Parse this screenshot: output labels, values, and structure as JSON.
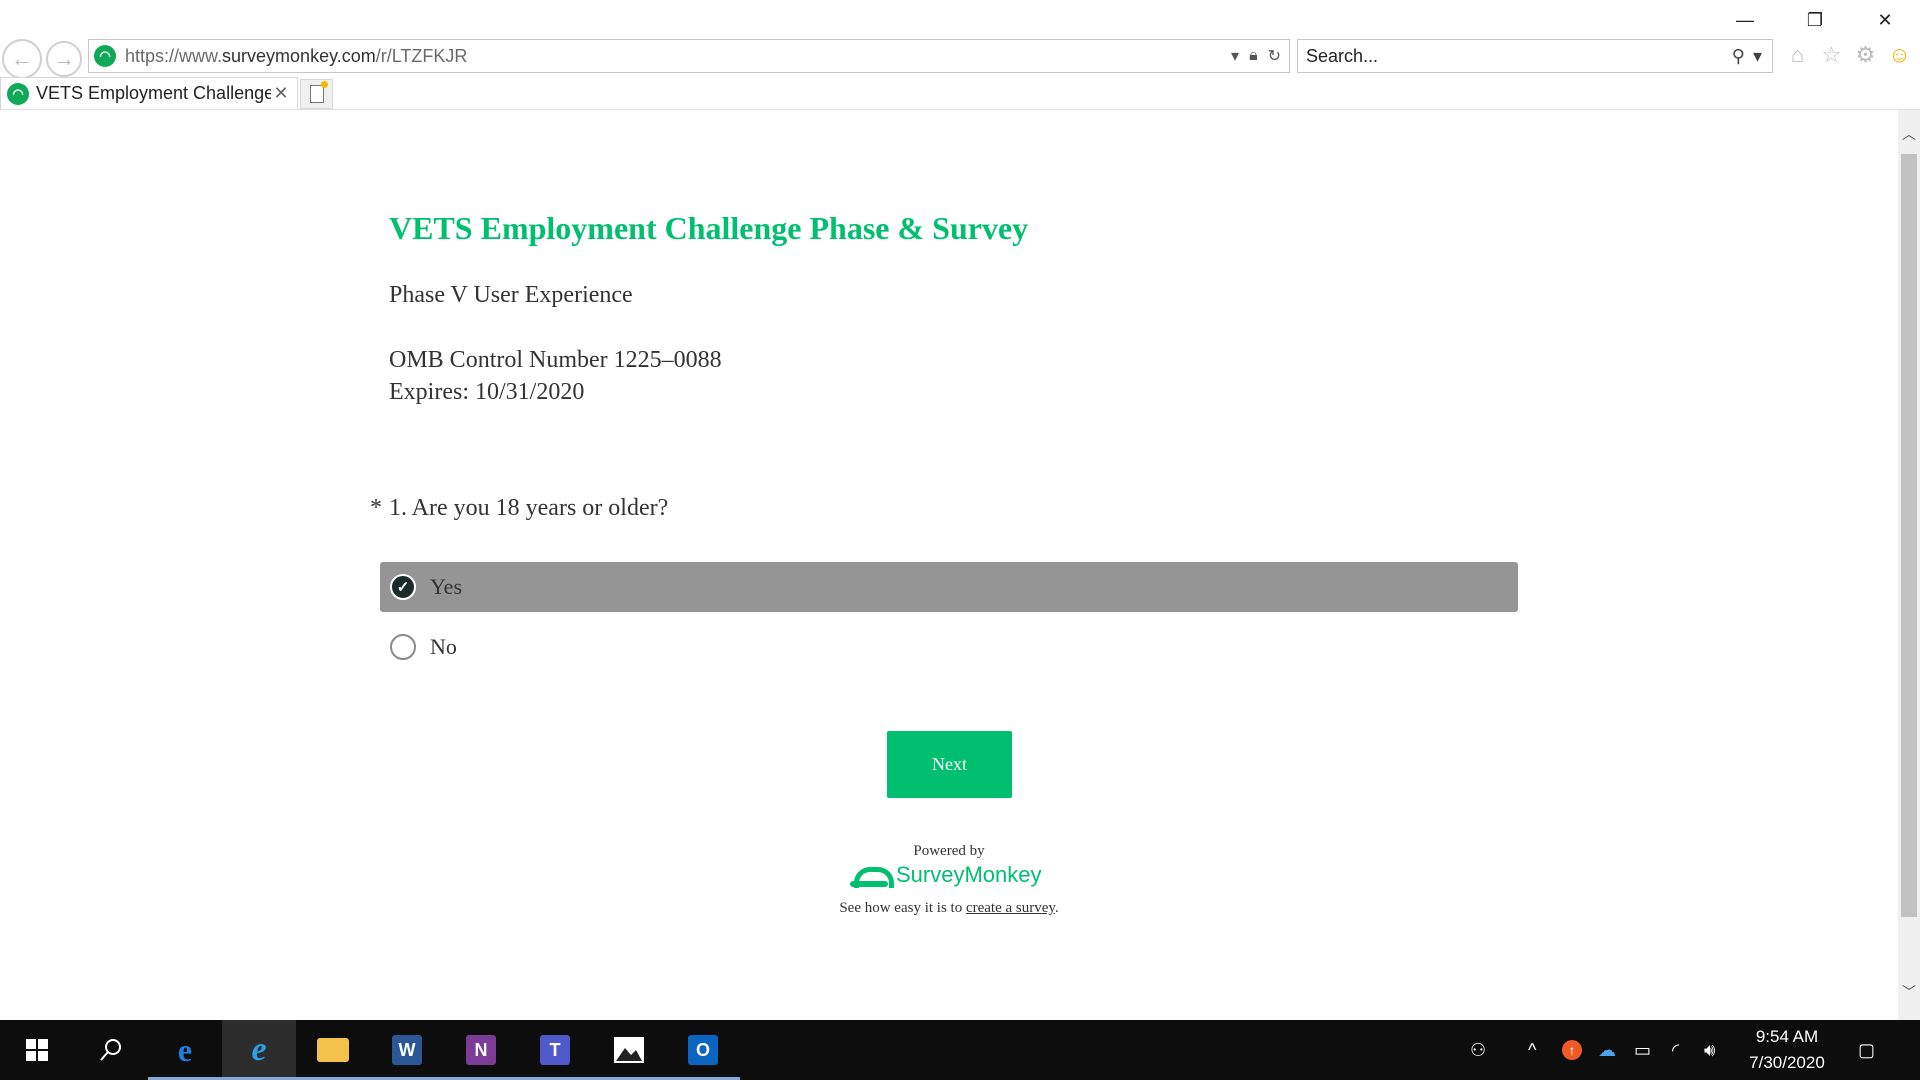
{
  "browser": {
    "url_prefix": "https://www.",
    "url_domain": "surveymonkey.com",
    "url_path": "/r/LTZFKJR",
    "search_placeholder": "Search...",
    "tab_title": "VETS Employment Challenge...",
    "window_controls": {
      "minimize": "—",
      "restore": "❐",
      "close": "✕"
    }
  },
  "survey": {
    "title": "VETS Employment Challenge Phase & Survey",
    "subtitle": "Phase V User Experience",
    "omb_line": "OMB Control Number 1225–0088",
    "expires_line": "Expires: 10/31/2020",
    "question": {
      "required_mark": "*",
      "text": "1. Are you 18 years or older?",
      "options": [
        {
          "label": "Yes",
          "selected": true
        },
        {
          "label": "No",
          "selected": false
        }
      ]
    },
    "next_label": "Next",
    "powered_by": "Powered by",
    "brand": "SurveyMonkey",
    "easy_prefix": "See how easy it is to ",
    "easy_link": "create a survey",
    "easy_suffix": "."
  },
  "taskbar": {
    "clock_time": "9:54 AM",
    "clock_date": "7/30/2020"
  },
  "colors": {
    "brand_green": "#00bf6f",
    "selected_row": "#959595",
    "taskbar": "#0d0d0d"
  }
}
